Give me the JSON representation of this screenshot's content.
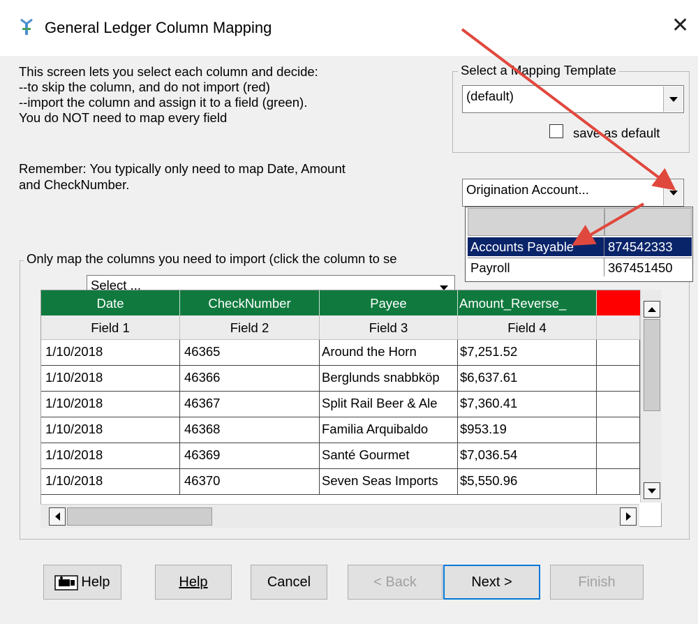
{
  "window": {
    "title": "General Ledger Column Mapping",
    "close_glyph": "✕"
  },
  "intro": {
    "lines": [
      "This screen lets you select each column and decide:",
      "--to skip the column, and do not import (red)",
      "--import the column and assign it to a field (green).",
      "You do NOT need to map every field"
    ],
    "remember_lines": [
      "Remember:  You typically only need to map Date, Amount",
      "and CheckNumber."
    ]
  },
  "template_group": {
    "legend": "Select a Mapping Template",
    "selected": "(default)",
    "save_default_label": "save as default",
    "save_default_checked": false
  },
  "origination": {
    "selected": "Origination Account...",
    "rows": [
      {
        "name": "Accounts Payable",
        "number": "874542333",
        "selected": true
      },
      {
        "name": "Payroll",
        "number": "367451450",
        "selected": false
      }
    ]
  },
  "mapping_group": {
    "legend": "Only map the columns you need to import (click the column to se",
    "select_value": "Select ..."
  },
  "grid": {
    "mapping_headers": [
      "Date",
      "CheckNumber",
      "Payee",
      "Amount_Reverse_",
      ""
    ],
    "field_headers": [
      "Field 1",
      "Field 2",
      "Field 3",
      "Field 4",
      ""
    ],
    "rows": [
      [
        "1/10/2018",
        "46365",
        "Around the Horn",
        "$7,251.52",
        ""
      ],
      [
        "1/10/2018",
        "46366",
        "Berglunds snabbköp",
        "$6,637.61",
        ""
      ],
      [
        "1/10/2018",
        "46367",
        "Split Rail Beer & Ale",
        "$7,360.41",
        ""
      ],
      [
        "1/10/2018",
        "46368",
        "Familia Arquibaldo",
        "$953.19",
        ""
      ],
      [
        "1/10/2018",
        "46369",
        "Santé Gourmet",
        "$7,036.54",
        ""
      ],
      [
        "1/10/2018",
        "46370",
        "Seven Seas Imports",
        "$5,550.96",
        ""
      ]
    ]
  },
  "buttons": {
    "icon_help": "Help",
    "help": "Help",
    "cancel": "Cancel",
    "back": "< Back",
    "next": "Next >",
    "finish": "Finish"
  },
  "colors": {
    "mapped": "#107a3e",
    "skipped": "#ff0000",
    "annotation_arrow": "#e0483d",
    "selection": "#0a246a"
  }
}
